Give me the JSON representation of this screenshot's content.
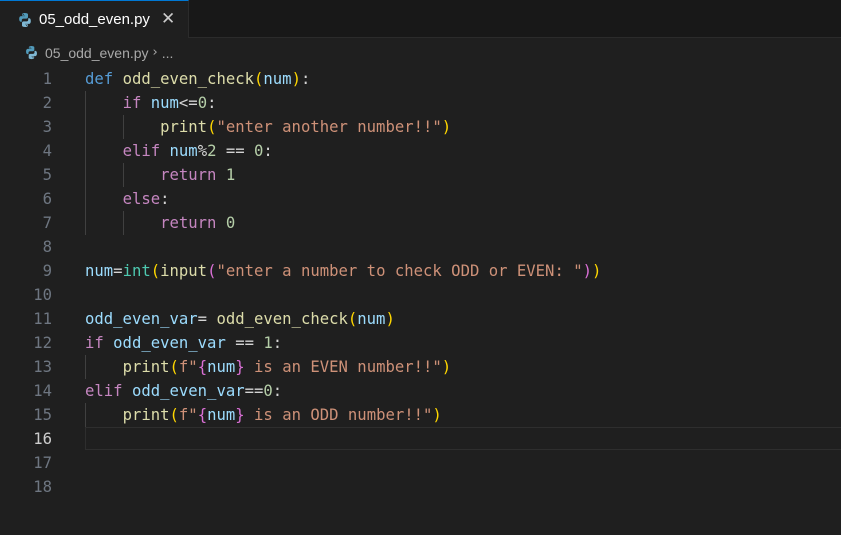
{
  "tab": {
    "label": "05_odd_even.py",
    "icon": "python-icon",
    "close_glyph": "✕"
  },
  "breadcrumb": {
    "file": "05_odd_even.py",
    "separator": "›",
    "more": "..."
  },
  "editor": {
    "current_line": 16,
    "lines": [
      {
        "num": "1",
        "tokens": [
          {
            "t": "def",
            "c": "k-def"
          },
          {
            "t": " ",
            "c": ""
          },
          {
            "t": "odd_even_check",
            "c": "fn"
          },
          {
            "t": "(",
            "c": "br1"
          },
          {
            "t": "num",
            "c": "var"
          },
          {
            "t": ")",
            "c": "br1"
          },
          {
            "t": ":",
            "c": "op"
          }
        ]
      },
      {
        "num": "2",
        "tokens": [
          {
            "t": "    ",
            "c": ""
          },
          {
            "t": "if",
            "c": "k-ctrl"
          },
          {
            "t": " ",
            "c": ""
          },
          {
            "t": "num",
            "c": "var"
          },
          {
            "t": "<=",
            "c": "op"
          },
          {
            "t": "0",
            "c": "num"
          },
          {
            "t": ":",
            "c": "op"
          }
        ]
      },
      {
        "num": "3",
        "tokens": [
          {
            "t": "        ",
            "c": ""
          },
          {
            "t": "print",
            "c": "fn"
          },
          {
            "t": "(",
            "c": "br1"
          },
          {
            "t": "\"enter another number!!\"",
            "c": "str"
          },
          {
            "t": ")",
            "c": "br1"
          }
        ]
      },
      {
        "num": "4",
        "tokens": [
          {
            "t": "    ",
            "c": ""
          },
          {
            "t": "elif",
            "c": "k-ctrl"
          },
          {
            "t": " ",
            "c": ""
          },
          {
            "t": "num",
            "c": "var"
          },
          {
            "t": "%",
            "c": "op"
          },
          {
            "t": "2",
            "c": "num"
          },
          {
            "t": " == ",
            "c": "op"
          },
          {
            "t": "0",
            "c": "num"
          },
          {
            "t": ":",
            "c": "op"
          }
        ]
      },
      {
        "num": "5",
        "tokens": [
          {
            "t": "        ",
            "c": ""
          },
          {
            "t": "return",
            "c": "k-ctrl"
          },
          {
            "t": " ",
            "c": ""
          },
          {
            "t": "1",
            "c": "num"
          }
        ]
      },
      {
        "num": "6",
        "tokens": [
          {
            "t": "    ",
            "c": ""
          },
          {
            "t": "else",
            "c": "k-ctrl"
          },
          {
            "t": ":",
            "c": "op"
          }
        ]
      },
      {
        "num": "7",
        "tokens": [
          {
            "t": "        ",
            "c": ""
          },
          {
            "t": "return",
            "c": "k-ctrl"
          },
          {
            "t": " ",
            "c": ""
          },
          {
            "t": "0",
            "c": "num"
          }
        ]
      },
      {
        "num": "8",
        "tokens": []
      },
      {
        "num": "9",
        "tokens": [
          {
            "t": "num",
            "c": "var"
          },
          {
            "t": "=",
            "c": "op"
          },
          {
            "t": "int",
            "c": "cls"
          },
          {
            "t": "(",
            "c": "br1"
          },
          {
            "t": "input",
            "c": "fn"
          },
          {
            "t": "(",
            "c": "br2"
          },
          {
            "t": "\"enter a number to check ODD or EVEN: \"",
            "c": "str"
          },
          {
            "t": ")",
            "c": "br2"
          },
          {
            "t": ")",
            "c": "br1"
          }
        ]
      },
      {
        "num": "10",
        "tokens": []
      },
      {
        "num": "11",
        "tokens": [
          {
            "t": "odd_even_var",
            "c": "var"
          },
          {
            "t": "= ",
            "c": "op"
          },
          {
            "t": "odd_even_check",
            "c": "fn"
          },
          {
            "t": "(",
            "c": "br1"
          },
          {
            "t": "num",
            "c": "var"
          },
          {
            "t": ")",
            "c": "br1"
          }
        ]
      },
      {
        "num": "12",
        "tokens": [
          {
            "t": "if",
            "c": "k-ctrl"
          },
          {
            "t": " ",
            "c": ""
          },
          {
            "t": "odd_even_var",
            "c": "var"
          },
          {
            "t": " == ",
            "c": "op"
          },
          {
            "t": "1",
            "c": "num"
          },
          {
            "t": ":",
            "c": "op"
          }
        ]
      },
      {
        "num": "13",
        "tokens": [
          {
            "t": "    ",
            "c": ""
          },
          {
            "t": "print",
            "c": "fn"
          },
          {
            "t": "(",
            "c": "br1"
          },
          {
            "t": "f\"",
            "c": "str"
          },
          {
            "t": "{",
            "c": "br2"
          },
          {
            "t": "num",
            "c": "var"
          },
          {
            "t": "}",
            "c": "br2"
          },
          {
            "t": " is an EVEN number!!\"",
            "c": "str"
          },
          {
            "t": ")",
            "c": "br1"
          }
        ]
      },
      {
        "num": "14",
        "tokens": [
          {
            "t": "elif",
            "c": "k-ctrl"
          },
          {
            "t": " ",
            "c": ""
          },
          {
            "t": "odd_even_var",
            "c": "var"
          },
          {
            "t": "==",
            "c": "op"
          },
          {
            "t": "0",
            "c": "num"
          },
          {
            "t": ":",
            "c": "op"
          }
        ]
      },
      {
        "num": "15",
        "tokens": [
          {
            "t": "    ",
            "c": ""
          },
          {
            "t": "print",
            "c": "fn"
          },
          {
            "t": "(",
            "c": "br1"
          },
          {
            "t": "f\"",
            "c": "str"
          },
          {
            "t": "{",
            "c": "br2"
          },
          {
            "t": "num",
            "c": "var"
          },
          {
            "t": "}",
            "c": "br2"
          },
          {
            "t": " is an ODD number!!\"",
            "c": "str"
          },
          {
            "t": ")",
            "c": "br1"
          }
        ]
      },
      {
        "num": "16",
        "tokens": []
      },
      {
        "num": "17",
        "tokens": []
      },
      {
        "num": "18",
        "tokens": []
      }
    ]
  }
}
